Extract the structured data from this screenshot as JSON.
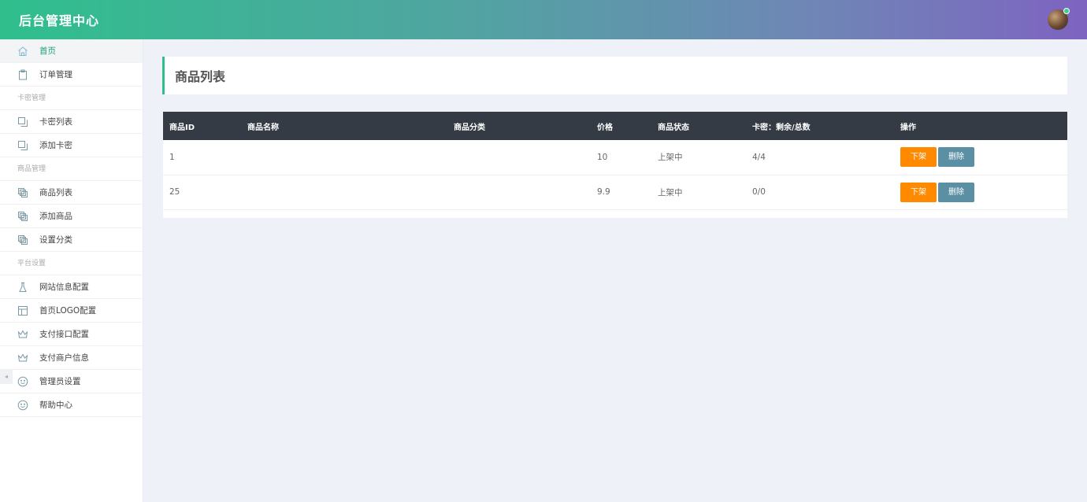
{
  "header": {
    "brand": "后台管理中心"
  },
  "sidebar": {
    "items": [
      {
        "type": "item",
        "label": "首页",
        "icon": "home-icon",
        "active": true
      },
      {
        "type": "item",
        "label": "订单管理",
        "icon": "clipboard-icon"
      },
      {
        "type": "group",
        "label": "卡密管理"
      },
      {
        "type": "item",
        "label": "卡密列表",
        "icon": "copy-icon"
      },
      {
        "type": "item",
        "label": "添加卡密",
        "icon": "copy-icon"
      },
      {
        "type": "group",
        "label": "商品管理"
      },
      {
        "type": "item",
        "label": "商品列表",
        "icon": "layers-icon"
      },
      {
        "type": "item",
        "label": "添加商品",
        "icon": "layers-icon"
      },
      {
        "type": "item",
        "label": "设置分类",
        "icon": "layers-icon"
      },
      {
        "type": "group",
        "label": "平台设置"
      },
      {
        "type": "item",
        "label": "网站信息配置",
        "icon": "flask-icon"
      },
      {
        "type": "item",
        "label": "首页LOGO配置",
        "icon": "layout-icon"
      },
      {
        "type": "item",
        "label": "支付接口配置",
        "icon": "crown-icon"
      },
      {
        "type": "item",
        "label": "支付商户信息",
        "icon": "crown-icon"
      },
      {
        "type": "item",
        "label": "管理员设置",
        "icon": "smile-icon"
      },
      {
        "type": "item",
        "label": "帮助中心",
        "icon": "smile-icon"
      }
    ]
  },
  "main": {
    "title": "商品列表",
    "table": {
      "headers": [
        "商品ID",
        "商品名称",
        "商品分类",
        "价格",
        "商品状态",
        "卡密：剩余/总数",
        "操作"
      ],
      "rows": [
        {
          "id": "1",
          "name": "",
          "category": "",
          "price": "10",
          "status": "上架中",
          "stock": "4/4"
        },
        {
          "id": "25",
          "name": "",
          "category": "",
          "price": "9.9",
          "status": "上架中",
          "stock": "0/0"
        }
      ],
      "actions": {
        "off_label": "下架",
        "delete_label": "删除"
      }
    }
  },
  "colors": {
    "accent": "#2fbf8d",
    "header_end": "#7e63c1",
    "btn_off": "#ff8a00",
    "btn_delete": "#5b8fa4",
    "table_head": "#353b44"
  }
}
